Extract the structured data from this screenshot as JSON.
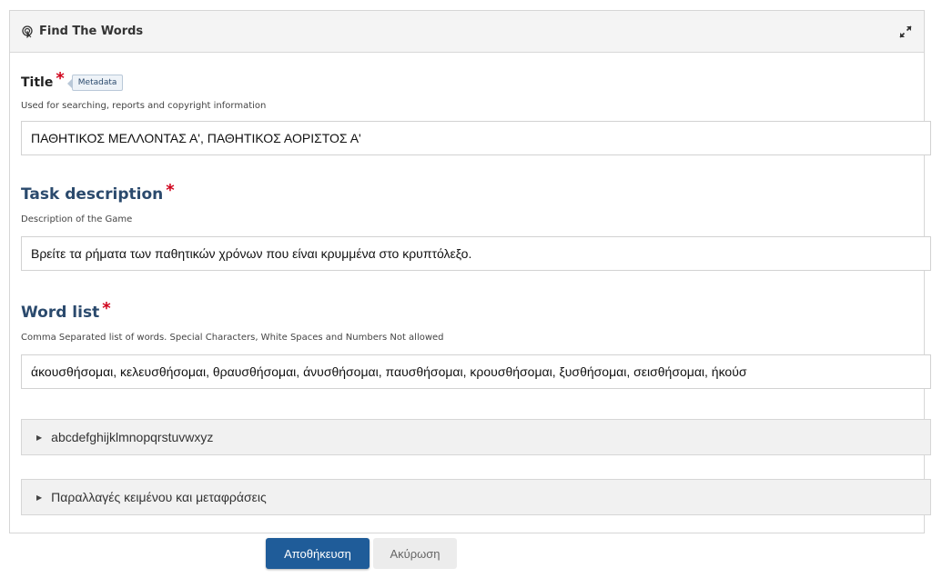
{
  "panel": {
    "header_title": "Find The Words",
    "header_icon": "hand-pointer-icon",
    "expand_icon": "expand-icon"
  },
  "fields": {
    "title": {
      "label": "Title",
      "required_mark": "*",
      "badge": "Metadata",
      "description": "Used for searching, reports and copyright information",
      "value": "ΠΑΘΗΤΙΚΟΣ ΜΕΛΛΟΝΤΑΣ Α',  ΠΑΘΗΤΙΚΟΣ ΑΟΡΙΣΤΟΣ Α'"
    },
    "task_description": {
      "label": "Task description",
      "required_mark": "*",
      "description": "Description of the Game",
      "value": "Βρείτε τα ρήματα των παθητικών χρόνων που είναι κρυμμένα στο κρυπτόλεξο."
    },
    "word_list": {
      "label": "Word list",
      "required_mark": "*",
      "description": "Comma Separated list of words. Special Characters, White Spaces and Numbers Not allowed",
      "value": "άκουσθήσομαι, κελευσθήσομαι, θραυσθήσομαι, άνυσθήσομαι, παυσθήσομαι, κρουσθήσομαι, ξυσθήσομαι, σεισθήσομαι, ήκούσ"
    }
  },
  "collapsibles": [
    {
      "label": "abcdefghijklmnopqrstuvwxyz"
    },
    {
      "label": "Παραλλαγές κειμένου και μεταφράσεις"
    }
  ],
  "buttons": {
    "save": "Αποθήκευση",
    "cancel": "Ακύρωση"
  },
  "colors": {
    "primary": "#1f5c99",
    "required": "#d0021b",
    "label_blue": "#2b4a6d"
  }
}
